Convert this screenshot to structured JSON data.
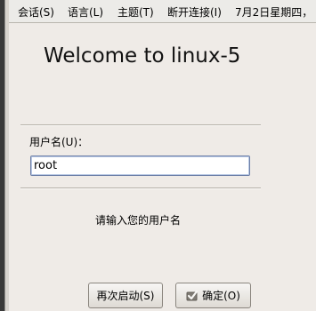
{
  "menu": {
    "session": "会话(S)",
    "language": "语言(L)",
    "theme": "主题(T)",
    "disconnect": "断开连接(I)",
    "clock": "7月2日星期四，"
  },
  "welcome_text": "Welcome to linux-5",
  "login": {
    "username_label": "用户名(U)：",
    "username_value": "root",
    "prompt": "请输入您的用户名"
  },
  "buttons": {
    "restart": "再次启动(S)",
    "ok": "确定(O)"
  },
  "icons": {
    "ok_button_icon": "checkmark-icon"
  }
}
